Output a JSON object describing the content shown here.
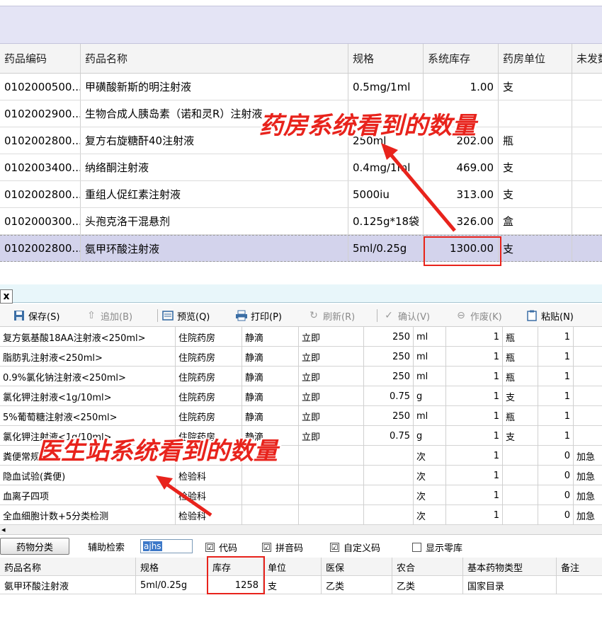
{
  "pharmacy": {
    "columns": [
      "药品编码",
      "药品名称",
      "规格",
      "系统库存",
      "药房单位",
      "未发数"
    ],
    "rows": [
      {
        "code": "0102000500...",
        "name": "甲磺酸新斯的明注射液",
        "spec": "0.5mg/1ml",
        "stock": "1.00",
        "unit": "支"
      },
      {
        "code": "0102002900...",
        "name": "生物合成人胰岛素（诺和灵R）注射液",
        "spec": "",
        "stock": "",
        "unit": ""
      },
      {
        "code": "0102002800...",
        "name": "复方右旋糖酐40注射液",
        "spec": "250ml",
        "stock": "202.00",
        "unit": "瓶"
      },
      {
        "code": "0102003400...",
        "name": "纳络酮注射液",
        "spec": "0.4mg/1ml",
        "stock": "469.00",
        "unit": "支"
      },
      {
        "code": "0102002800...",
        "name": "重组人促红素注射液",
        "spec": "5000iu",
        "stock": "313.00",
        "unit": "支"
      },
      {
        "code": "0102000300...",
        "name": "头孢克洛干混悬剂",
        "spec": "0.125g*18袋",
        "stock": "326.00",
        "unit": "盒"
      },
      {
        "code": "0102002800...",
        "name": "氨甲环酸注射液",
        "spec": "5ml/0.25g",
        "stock": "1300.00",
        "unit": "支"
      }
    ]
  },
  "tab": {
    "close_label": "x"
  },
  "toolbar": {
    "save": "保存(S)",
    "add": "追加(B)",
    "preview": "预览(Q)",
    "print": "打印(P)",
    "refresh": "刷新(R)",
    "confirm": "确认(V)",
    "void": "作废(K)",
    "paste": "粘贴(N)"
  },
  "orders": [
    {
      "name": "复方氨基酸18AA注射液<250ml>",
      "dept": "住院药房",
      "route": "静滴",
      "freq": "立即",
      "dose": "250",
      "dose_unit": "ml",
      "qty": "1",
      "qty_unit": "瓶",
      "n": "1",
      "urgent": ""
    },
    {
      "name": "脂肪乳注射液<250ml>",
      "dept": "住院药房",
      "route": "静滴",
      "freq": "立即",
      "dose": "250",
      "dose_unit": "ml",
      "qty": "1",
      "qty_unit": "瓶",
      "n": "1",
      "urgent": ""
    },
    {
      "name": "0.9%氯化钠注射液<250ml>",
      "dept": "住院药房",
      "route": "静滴",
      "freq": "立即",
      "dose": "250",
      "dose_unit": "ml",
      "qty": "1",
      "qty_unit": "瓶",
      "n": "1",
      "urgent": ""
    },
    {
      "name": "氯化钾注射液<1g/10ml>",
      "dept": "住院药房",
      "route": "静滴",
      "freq": "立即",
      "dose": "0.75",
      "dose_unit": "g",
      "qty": "1",
      "qty_unit": "支",
      "n": "1",
      "urgent": ""
    },
    {
      "name": "5%葡萄糖注射液<250ml>",
      "dept": "住院药房",
      "route": "静滴",
      "freq": "立即",
      "dose": "250",
      "dose_unit": "ml",
      "qty": "1",
      "qty_unit": "瓶",
      "n": "1",
      "urgent": ""
    },
    {
      "name": "氯化钾注射液<1g/10ml>",
      "dept": "住院药房",
      "route": "静滴",
      "freq": "立即",
      "dose": "0.75",
      "dose_unit": "g",
      "qty": "1",
      "qty_unit": "支",
      "n": "1",
      "urgent": ""
    },
    {
      "name": "粪便常规检查",
      "dept": "",
      "route": "",
      "freq": "",
      "dose": "",
      "dose_unit": "次",
      "qty": "1",
      "qty_unit": "",
      "n": "0",
      "urgent": "加急"
    },
    {
      "name": "隐血试验(粪便)",
      "dept": "检验科",
      "route": "",
      "freq": "",
      "dose": "",
      "dose_unit": "次",
      "qty": "1",
      "qty_unit": "",
      "n": "0",
      "urgent": "加急"
    },
    {
      "name": "血离子四项",
      "dept": "检验科",
      "route": "",
      "freq": "",
      "dose": "",
      "dose_unit": "次",
      "qty": "1",
      "qty_unit": "",
      "n": "0",
      "urgent": "加急"
    },
    {
      "name": "全血细胞计数+5分类检测",
      "dept": "检验科",
      "route": "",
      "freq": "",
      "dose": "",
      "dose_unit": "次",
      "qty": "1",
      "qty_unit": "",
      "n": "0",
      "urgent": "加急"
    }
  ],
  "search": {
    "class_button": "药物分类",
    "aux_label": "辅助检索",
    "value": "ajhs",
    "checkboxes": [
      {
        "label": "代码",
        "checked": "☑"
      },
      {
        "label": "拼音码",
        "checked": "☑"
      },
      {
        "label": "自定义码",
        "checked": "☑"
      },
      {
        "label": "显示零库",
        "checked": ""
      }
    ]
  },
  "drug_list": {
    "columns": [
      "药品名称",
      "规格",
      "库存",
      "单位",
      "医保",
      "农合",
      "基本药物类型",
      "备注"
    ],
    "row": {
      "name": "氨甲环酸注射液",
      "spec": "5ml/0.25g",
      "stock": "1258",
      "unit": "支",
      "insurance": "乙类",
      "rural": "乙类",
      "essential_type": "国家目录",
      "note": ""
    }
  },
  "annotations": {
    "pharmacy": "药房系统看到的数量",
    "doctor": "医生站系统看到的数量"
  },
  "colors": {
    "annotation": "#e8231c",
    "selected_row": "#d3d3ec",
    "banner": "#e4e4f5"
  }
}
